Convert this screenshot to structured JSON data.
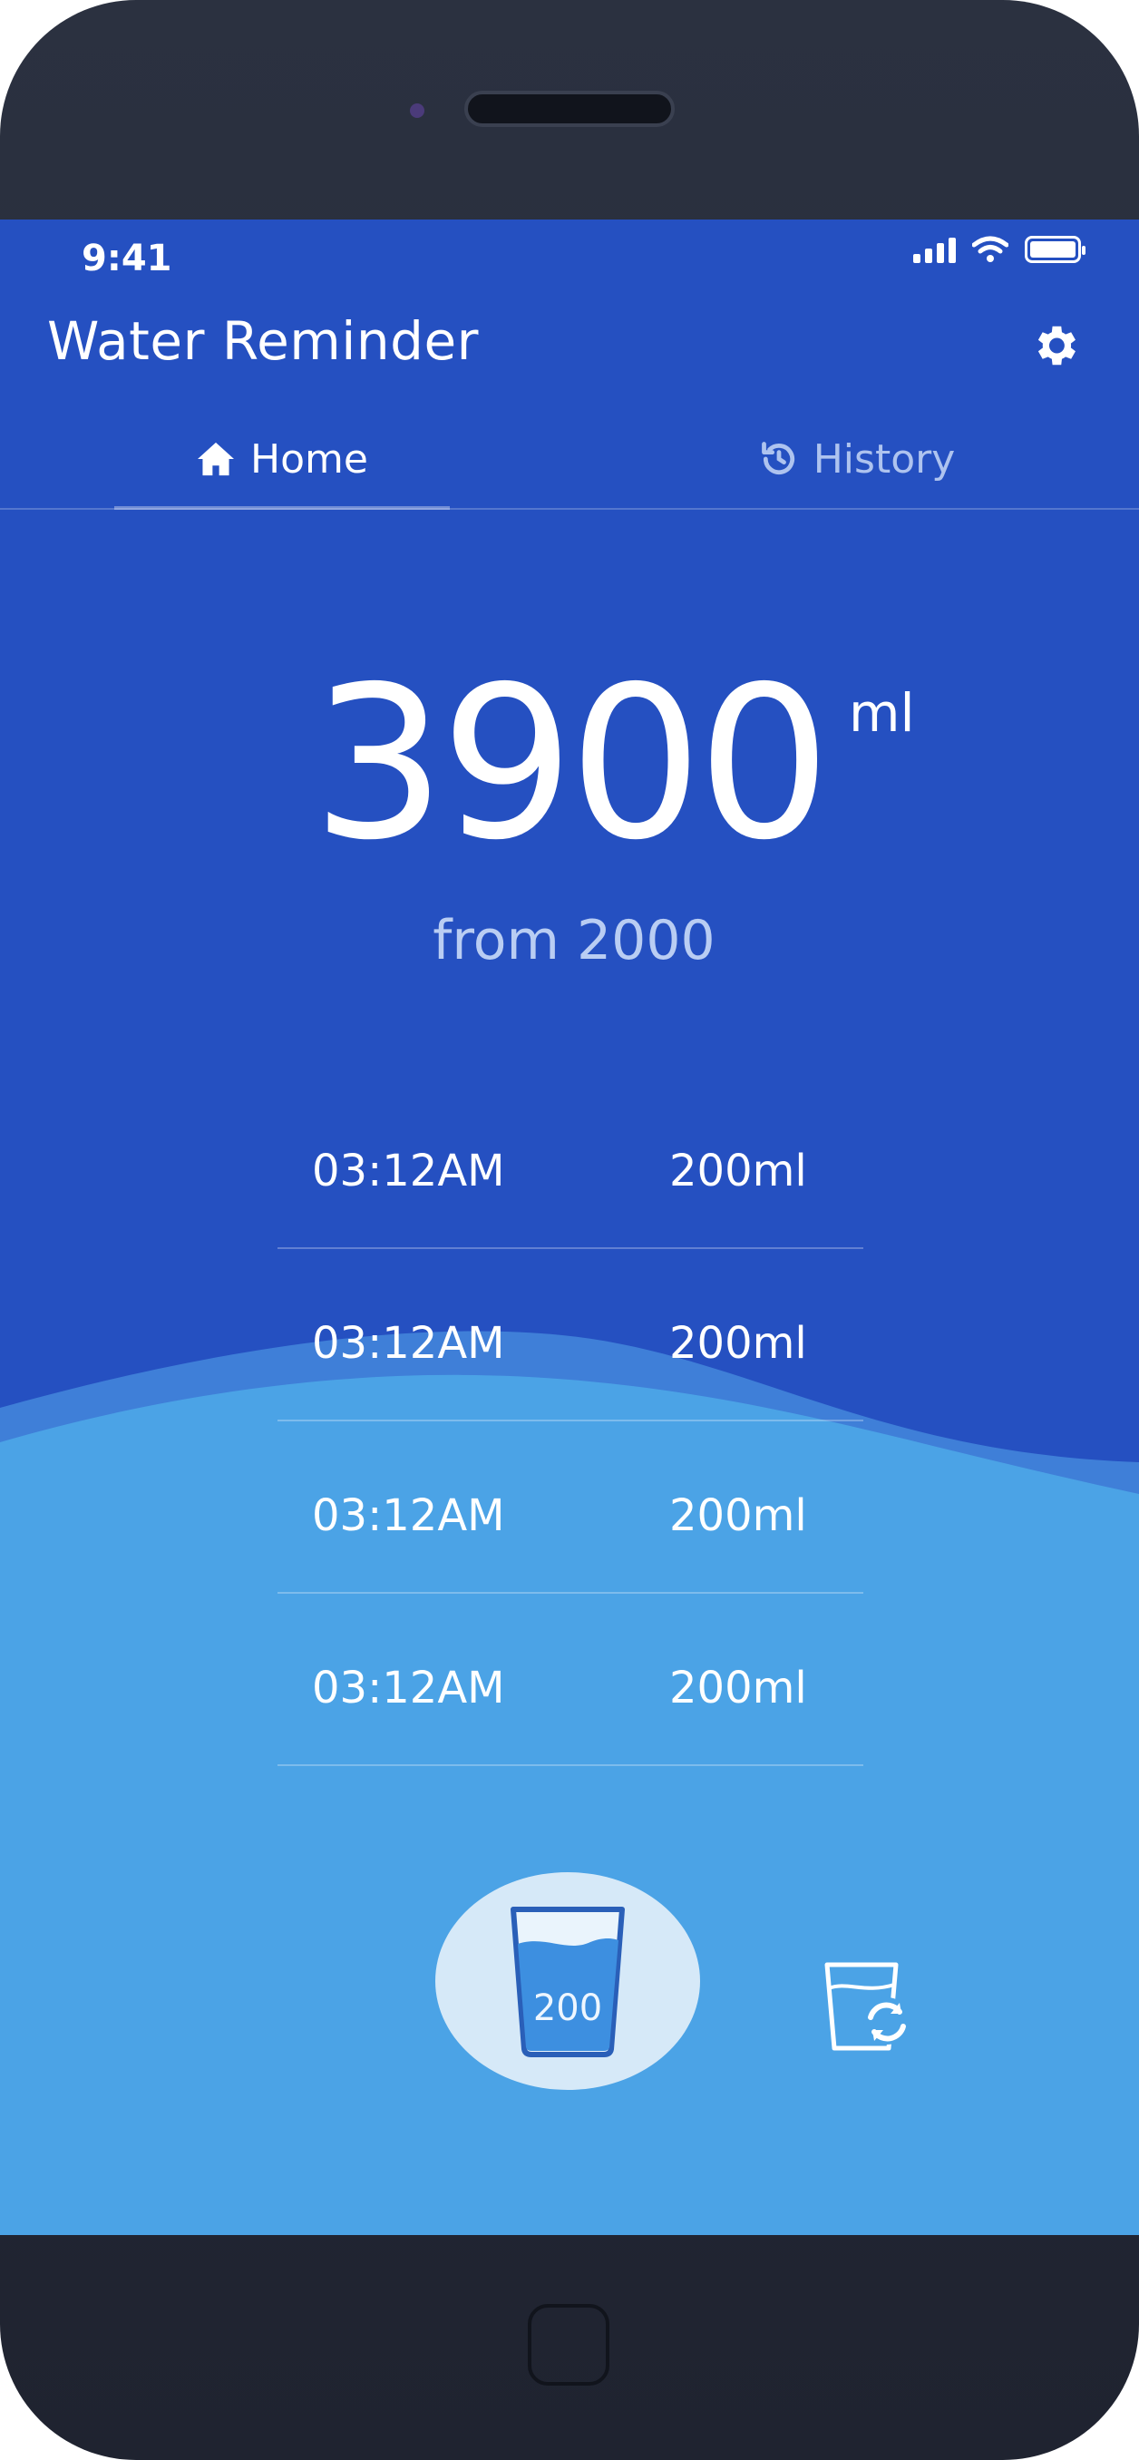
{
  "status_bar": {
    "time": "9:41",
    "icons": [
      "cellular-signal-icon",
      "wifi-icon",
      "battery-icon"
    ]
  },
  "header": {
    "title": "Water Reminder",
    "settings_icon": "gear-icon"
  },
  "tabs": [
    {
      "label": "Home",
      "icon": "home-icon",
      "active": true
    },
    {
      "label": "History",
      "icon": "history-icon",
      "active": false
    }
  ],
  "summary": {
    "total": "3900",
    "unit": "ml",
    "goal_text": "from 2000"
  },
  "log": [
    {
      "time": "03:12AM",
      "amount": "200ml"
    },
    {
      "time": "03:12AM",
      "amount": "200ml"
    },
    {
      "time": "03:12AM",
      "amount": "200ml"
    },
    {
      "time": "03:12AM",
      "amount": "200ml"
    }
  ],
  "drink_button": {
    "label": "200",
    "icon": "water-glass-icon"
  },
  "switch_cup_icon": "cup-switch-icon",
  "colors": {
    "screen_bg": "#2550c1",
    "wave_back": "#3f7fd8",
    "wave_front": "#4ba3e6",
    "device_frame": "#1f2330"
  }
}
